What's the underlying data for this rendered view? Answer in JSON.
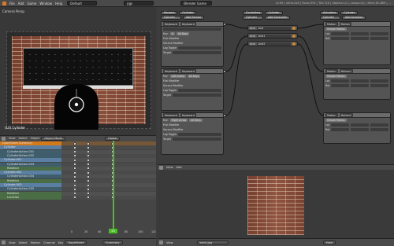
{
  "topbar": {
    "menus": [
      "File",
      "Add",
      "Game",
      "Window",
      "Help"
    ],
    "layout": "Default",
    "scene": "jigs",
    "engine": "Blender Game",
    "info": "v2.69 | Verts:418 | Faces:392 | Tris:716 | Objects:1/1 | Lamps:0/1 | Mem:36.28M | ..."
  },
  "viewport": {
    "label": "Camera Persp",
    "object": "(10) Cylinder",
    "header": {
      "view": "View",
      "select": "Select",
      "object": "Object",
      "mode": "Object Mode",
      "global": "Global"
    }
  },
  "dopesheet": {
    "rows": [
      {
        "name": "DopeSheet Summary",
        "kind": "summary"
      },
      {
        "name": "Cylinder",
        "kind": "object"
      },
      {
        "name": "CylinderAction.001",
        "kind": "action"
      },
      {
        "name": "CylinderAction.002",
        "kind": "action"
      },
      {
        "name": "Cylinder.001",
        "kind": "object"
      },
      {
        "name": "CylinderAction.003",
        "kind": "action"
      },
      {
        "name": "Rotation",
        "kind": "group"
      },
      {
        "name": "Cylinder.002",
        "kind": "object"
      },
      {
        "name": "CylinderAction.004",
        "kind": "action"
      },
      {
        "name": "Rotation",
        "kind": "group"
      },
      {
        "name": "Cylinder.003",
        "kind": "object"
      },
      {
        "name": "CylinderAction.005",
        "kind": "action"
      },
      {
        "name": "Rotation",
        "kind": "group"
      },
      {
        "name": "Location",
        "kind": "group"
      }
    ],
    "ticks": [
      "0",
      "20",
      "40",
      "60",
      "80",
      "100",
      "120"
    ],
    "current_frame": "20",
    "header": {
      "view": "View",
      "select": "Select",
      "marker": "Marker",
      "channel": "Channel",
      "key": "Key",
      "mode": "DopeSheet",
      "summary": "Summary"
    }
  },
  "logic": {
    "sensors": {
      "title": "Sensors",
      "object": "Cylinder",
      "add": "Add Sensor",
      "blocks": [
        {
          "type": "Keyboard",
          "name": "Keyboard",
          "key": "A",
          "tap": "Tap",
          "all": "All Keys",
          "modifier": "First Modifier",
          "modifier2": "Second Modifier",
          "log": "Log Toggle",
          "target": "Target"
        },
        {
          "type": "Keyboard",
          "name": "Keyboard",
          "key": "Left Arrow",
          "tap": "Tap",
          "all": "All Keys",
          "modifier": "First Modifier",
          "modifier2": "Second Modifier",
          "log": "Log Toggle",
          "target": "Target"
        },
        {
          "type": "Keyboard",
          "name": "Keyboard",
          "key": "Right Arrow",
          "tap": "Tap",
          "all": "All Keys",
          "modifier": "First Modifier",
          "modifier2": "Second Modifier",
          "log": "Log Toggle",
          "target": "Target"
        }
      ]
    },
    "controllers": {
      "title": "Controllers",
      "object": "Cylinder",
      "add": "Add Controller",
      "items": [
        {
          "type": "And",
          "name": "And"
        },
        {
          "type": "And",
          "name": "And1"
        },
        {
          "type": "And",
          "name": "And2"
        }
      ]
    },
    "actuators": {
      "title": "Actuators",
      "object": "Cylinder",
      "add": "Add Actuator",
      "blocks": [
        {
          "type": "Motion",
          "name": "Motion",
          "mtype": "Simple Motion",
          "loc": "Loc",
          "rot": "Rot"
        },
        {
          "type": "Motion",
          "name": "Motion1",
          "mtype": "Simple Motion",
          "loc": "Loc",
          "rot": "Rot"
        },
        {
          "type": "Motion",
          "name": "Motion2",
          "mtype": "Simple Motion",
          "loc": "Loc",
          "rot": "Rot"
        }
      ]
    }
  },
  "image_editor": {
    "header": {
      "view": "View",
      "add": "Add",
      "image": "brick.jpg",
      "view2": "View"
    }
  },
  "colors": {
    "accent": "#48c020",
    "summary": "#d57a1a",
    "object_row": "#5a7fa3",
    "action_row": "#405d6c",
    "group_row": "#4b6d45"
  }
}
